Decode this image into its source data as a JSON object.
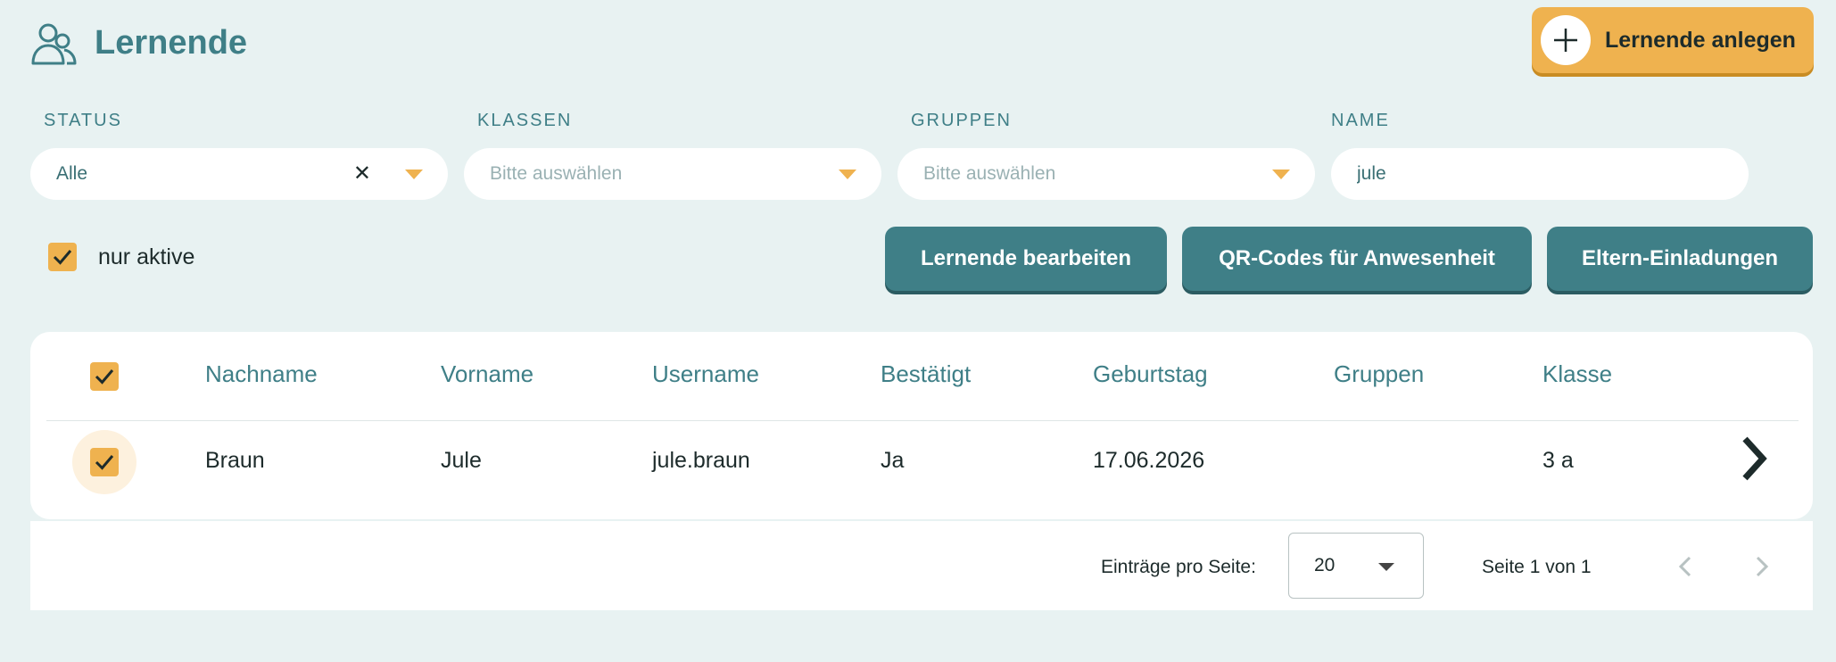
{
  "header": {
    "title": "Lernende",
    "icon": "users-icon"
  },
  "add_button": {
    "label": "Lernende anlegen",
    "icon": "plus-icon"
  },
  "filters": {
    "status": {
      "label": "STATUS",
      "value": "Alle"
    },
    "klassen": {
      "label": "KLASSEN",
      "placeholder": "Bitte auswählen"
    },
    "gruppen": {
      "label": "GRUPPEN",
      "placeholder": "Bitte auswählen"
    },
    "name": {
      "label": "NAME",
      "value": "jule"
    }
  },
  "only_active": {
    "label": "nur aktive",
    "checked": true
  },
  "actions": {
    "edit": "Lernende bearbeiten",
    "qr": "QR-Codes für Anwesenheit",
    "invites": "Eltern-Einladungen"
  },
  "table": {
    "columns": [
      "Nachname",
      "Vorname",
      "Username",
      "Bestätigt",
      "Geburtstag",
      "Gruppen",
      "Klasse"
    ],
    "rows": [
      {
        "nachname": "Braun",
        "vorname": "Jule",
        "username": "jule.braun",
        "bestaetigt": "Ja",
        "geburtstag": "17.06.2026",
        "gruppen": "",
        "klasse": "3 a",
        "selected": true
      }
    ]
  },
  "pagination": {
    "per_page_label": "Einträge pro Seite:",
    "per_page": "20",
    "page_info": "Seite 1 von 1"
  },
  "colors": {
    "accent": "#efb24f",
    "primary": "#3f7f87",
    "background": "#e8f2f2"
  }
}
